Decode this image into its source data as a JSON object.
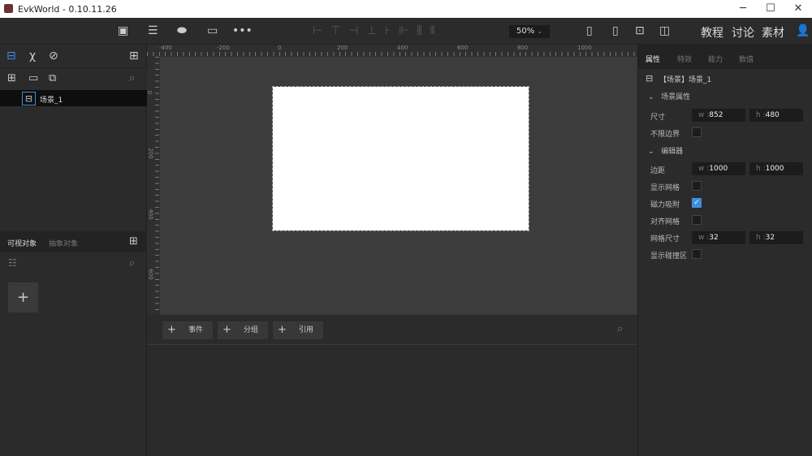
{
  "window": {
    "title": "EvkWorld - 0.10.11.26",
    "minimize": "─",
    "maximize": "☐",
    "close": "✕"
  },
  "toolbar": {
    "zoom": "50%",
    "links": [
      "教程",
      "讨论",
      "素材"
    ]
  },
  "left_panel": {
    "tree_items": [
      {
        "label": "场景_1"
      }
    ],
    "tabs": [
      "可视对象",
      "抽象对象"
    ],
    "add_label": "+"
  },
  "rulers": {
    "top": [
      "-400",
      "-200",
      "0",
      "200",
      "400",
      "600",
      "800",
      "1000"
    ],
    "left": [
      "0",
      "200",
      "400",
      "600"
    ]
  },
  "bottom_bar": {
    "buttons": [
      "事件",
      "分组",
      "引用"
    ]
  },
  "right_panel": {
    "tabs": [
      "属性",
      "特效",
      "能力",
      "数值"
    ],
    "selected": "【场景】场景_1",
    "section_scene": "场景属性",
    "size_label": "尺寸",
    "size_w": "852",
    "size_h": "480",
    "unbounded_label": "不限边界",
    "unbounded": false,
    "section_editor": "编辑器",
    "margin_label": "边距",
    "margin_w": "1000",
    "margin_h": "1000",
    "show_grid_label": "显示网格",
    "show_grid": false,
    "snap_label": "磁力吸附",
    "snap": true,
    "align_grid_label": "对齐网格",
    "align_grid": false,
    "grid_size_label": "网格尺寸",
    "grid_w": "32",
    "grid_h": "32",
    "show_collision_label": "显示碰撞区",
    "show_collision": false,
    "w_prefix": "w :",
    "h_prefix": "h :"
  }
}
